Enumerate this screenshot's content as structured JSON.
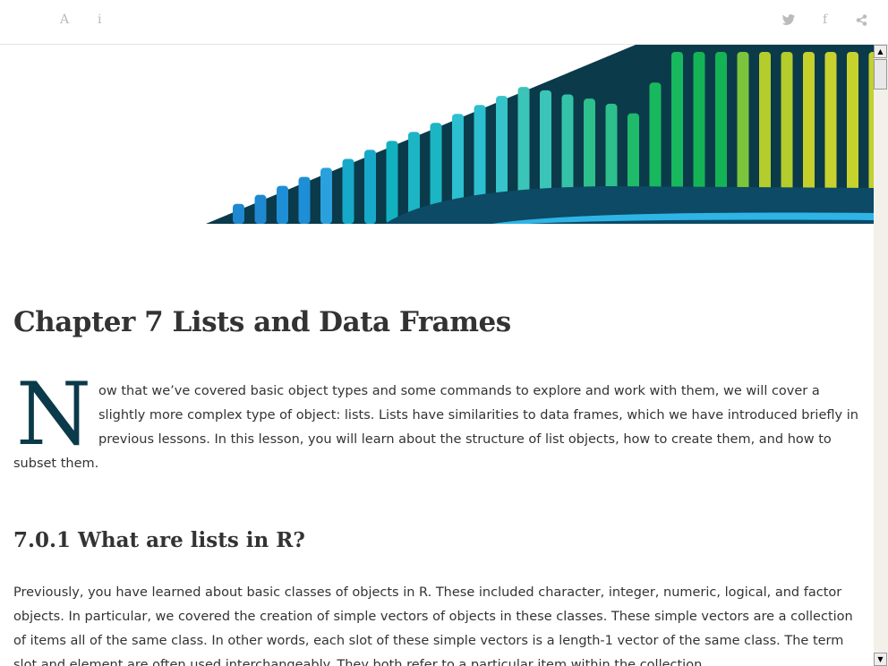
{
  "toolbar": {
    "font_icon": "A",
    "info_icon": "i",
    "twitter_icon": "twitter-icon",
    "facebook_icon": "f",
    "share_icon": "share-icon"
  },
  "chapter": {
    "title": "Chapter 7   Lists and Data Frames",
    "drop_cap": "N",
    "intro": "ow that we’ve covered basic object types and some commands to explore and work with them, we will cover a slightly more complex type of object: lists. Lists have similarities to data frames, which we have introduced briefly in previous lessons. In this lesson, you will learn about the structure of list objects, how to create them, and how to subset them."
  },
  "section": {
    "title": "7.0.1   What are lists in R?",
    "paragraph": "Previously, you have learned about basic classes of objects in R. These included character, integer, numeric, logical, and factor objects. In particular, we covered the creation of simple vectors of objects in these classes. These simple vectors are a collection of items all of the same class. In other words, each slot of these simple vectors is a length-1 vector of the same class. The term slot and element are often used interchangeably. They both refer to a particular item within the collection"
  }
}
